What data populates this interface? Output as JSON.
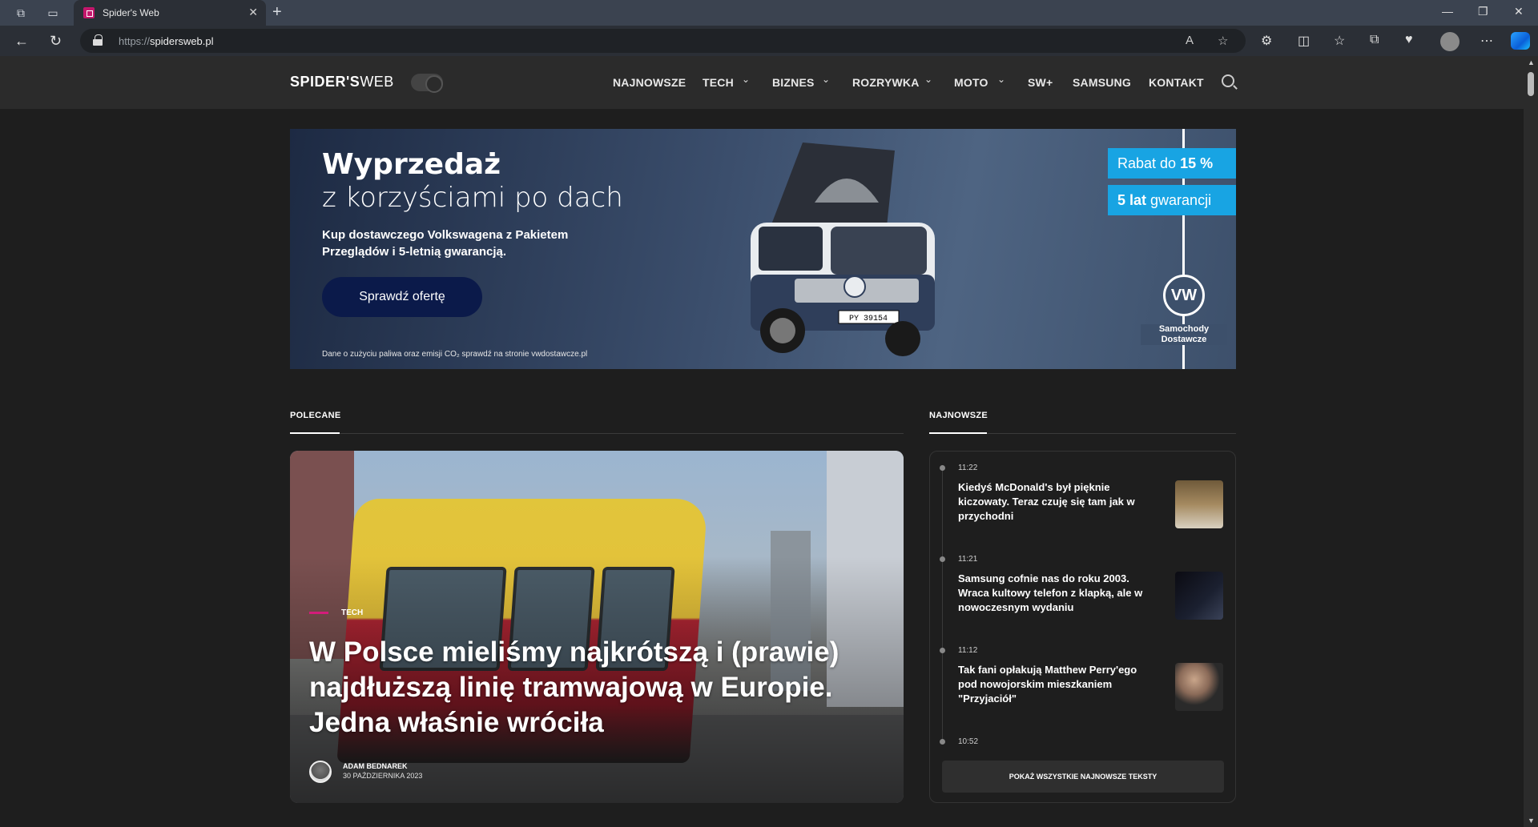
{
  "browser": {
    "tab_title": "Spider's Web",
    "url_prefix": "https://",
    "url_domain": "spidersweb.pl"
  },
  "site": {
    "logo_bold": "SPIDER'S",
    "logo_light": "WEB",
    "nav": [
      {
        "label": "NAJNOWSZE"
      },
      {
        "label": "TECH"
      },
      {
        "label": "BIZNES"
      },
      {
        "label": "ROZRYWKA"
      },
      {
        "label": "MOTO"
      },
      {
        "label": "SW+"
      },
      {
        "label": "SAMSUNG"
      },
      {
        "label": "KONTAKT"
      }
    ]
  },
  "ad": {
    "headline": "Wyprzedaż",
    "subheadline": "z korzyściami po dach",
    "body": "Kup dostawczego Volkswagena z Pakietem Przeglądów i 5-letnią gwarancją.",
    "cta": "Sprawdź ofertę",
    "footnote": "Dane o zużyciu paliwa oraz emisji CO₂ sprawdź na stronie vwdostawcze.pl",
    "tag1_prefix": "Rabat do ",
    "tag1_value": "15 %",
    "tag2_value": "5 lat",
    "tag2_suffix": " gwarancji",
    "plate": "PY 39154",
    "brand_line1": "Samochody",
    "brand_line2": "Dostawcze",
    "colors": {
      "cta_bg": "#0b1a4a",
      "tag_bg": "#18a4e3"
    }
  },
  "polecane": {
    "label": "POLECANE",
    "hero": {
      "category": "TECH",
      "title": "W Polsce mieliśmy najkrótszą i (prawie) najdłuższą linię tramwajową w Europie. Jedna właśnie wróciła",
      "author": "ADAM BEDNAREK",
      "date": "30 PAŹDZIERNIKA 2023"
    }
  },
  "najnowsze": {
    "label": "NAJNOWSZE",
    "items": [
      {
        "time": "11:22",
        "title": "Kiedyś McDonald's był pięknie kiczowaty. Teraz czuję się tam jak w przychodni"
      },
      {
        "time": "11:21",
        "title": "Samsung cofnie nas do roku 2003. Wraca kultowy telefon z klapką, ale w nowoczesnym wydaniu"
      },
      {
        "time": "11:12",
        "title": "Tak fani opłakują Matthew Perry'ego pod nowojorskim mieszkaniem \"Przyjaciół\""
      },
      {
        "time": "10:52",
        "title": ""
      }
    ],
    "show_all": "POKAŻ WSZYSTKIE NAJNOWSZE TEKSTY"
  }
}
